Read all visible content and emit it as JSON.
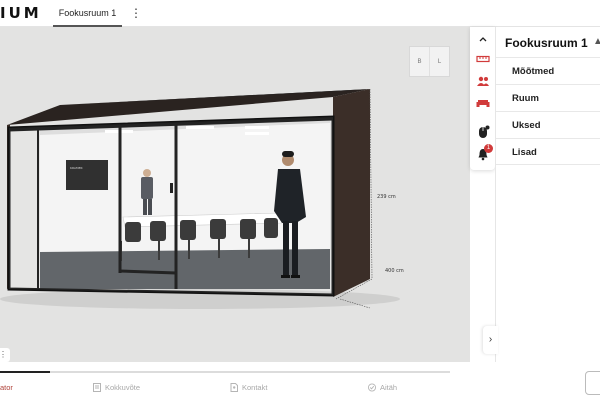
{
  "app": {
    "logo_text": "IUM",
    "active_tab": "Fookusruum 1",
    "menu_icon": "kebab-icon"
  },
  "viewport": {
    "view_cube_left": "B",
    "view_cube_right": "L",
    "dimensions": {
      "height": "239 cm",
      "depth": "400 cm"
    },
    "tv_text": "KRAMER"
  },
  "toolbar": {
    "items": [
      {
        "icon": "chevron-up-icon"
      },
      {
        "icon": "ruler-icon"
      },
      {
        "icon": "people-icon"
      },
      {
        "icon": "sofa-icon"
      },
      {
        "icon": "mouse-icon"
      },
      {
        "icon": "bell-icon",
        "badge": "1"
      }
    ]
  },
  "panel": {
    "title": "Fookusruum 1",
    "menu": [
      "Mõõtmed",
      "Ruum",
      "Uksed",
      "Lisad"
    ]
  },
  "stepper": {
    "progress_percent": 11,
    "steps": [
      {
        "label": "ator",
        "active": true
      },
      {
        "label": "Kokkuvõte",
        "active": false
      },
      {
        "label": "Kontakt",
        "active": false
      },
      {
        "label": "Aitäh",
        "active": false
      }
    ]
  },
  "colors": {
    "accent": "#d13b3b",
    "viewport_bg": "#e3e3e2",
    "frame": "#1a1a1a",
    "wall": "#3b2e28"
  }
}
